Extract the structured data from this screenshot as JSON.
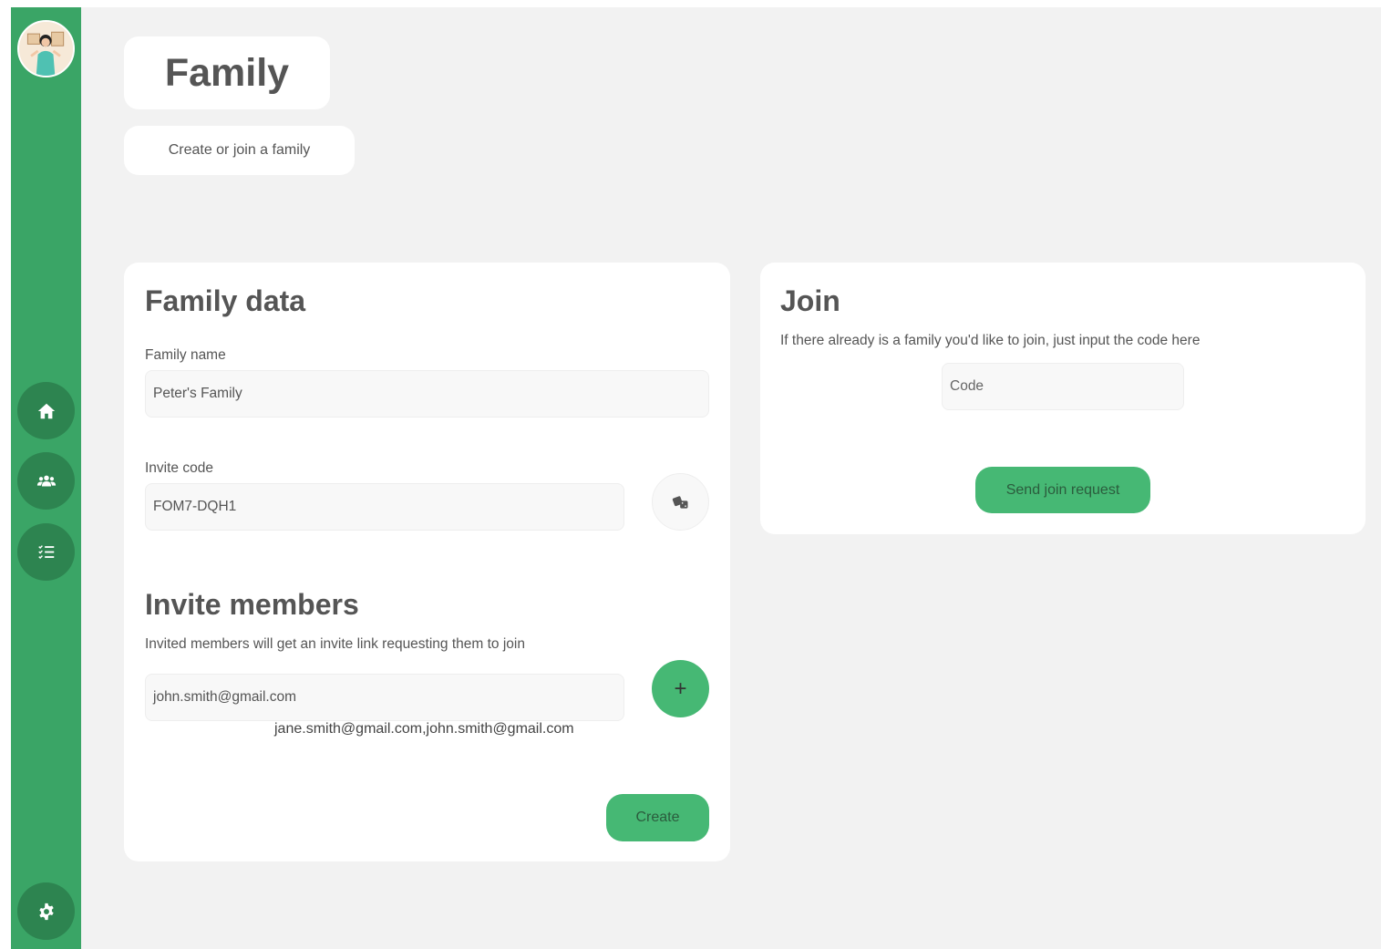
{
  "app": {
    "page_title": "Family",
    "page_subtitle": "Create or join a family"
  },
  "sidebar": {
    "items": [
      {
        "name": "home",
        "icon": "home-icon"
      },
      {
        "name": "family",
        "icon": "users-icon"
      },
      {
        "name": "tasks",
        "icon": "checklist-icon"
      }
    ],
    "settings_icon": "gear-icon"
  },
  "family_data": {
    "heading": "Family data",
    "name_label": "Family name",
    "name_value": "Peter's Family",
    "invite_code_label": "Invite code",
    "invite_code_value": "FOM7-DQH1",
    "regenerate_icon": "dice-icon"
  },
  "invite_members": {
    "heading": "Invite members",
    "description": "Invited members will get an invite link requesting them to join",
    "email_value": "john.smith@gmail.com",
    "add_label": "+",
    "invited_list": "jane.smith@gmail.com,john.smith@gmail.com",
    "create_label": "Create"
  },
  "join": {
    "heading": "Join",
    "description": "If there already is a family you'd like to join, just input the code here",
    "code_placeholder": "Code",
    "submit_label": "Send join request"
  },
  "colors": {
    "sidebar": "#3aa566",
    "nav_button": "#2d8450",
    "accent": "#46b874",
    "background": "#f2f2f2"
  }
}
